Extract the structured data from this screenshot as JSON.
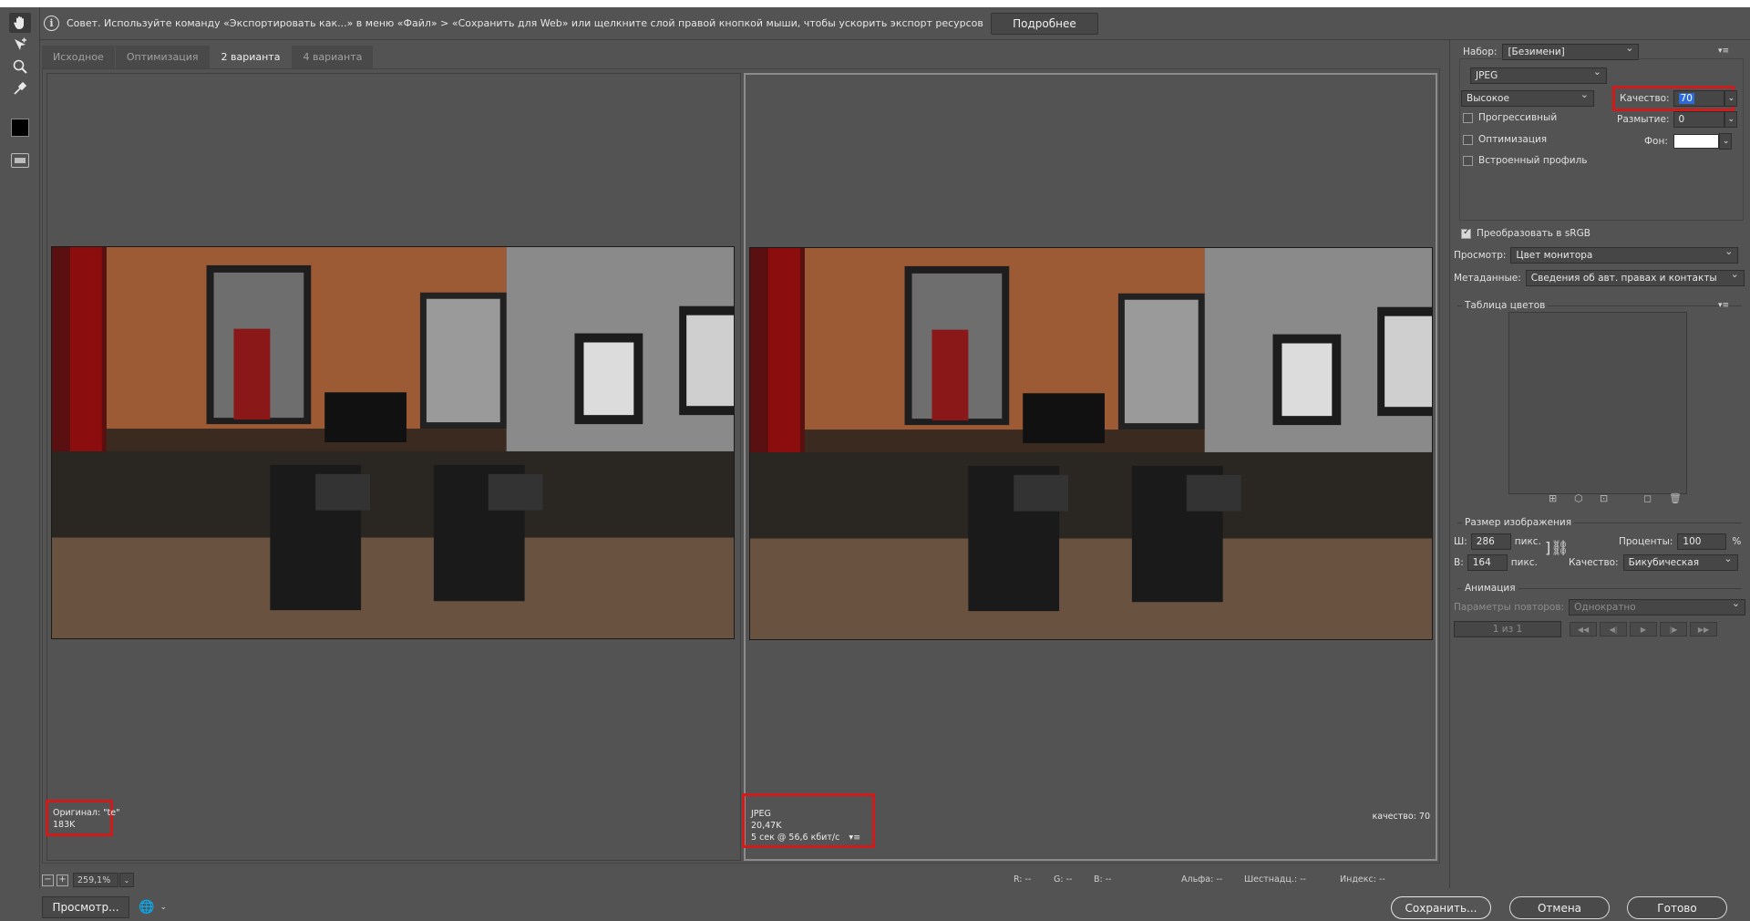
{
  "tip": {
    "text": "Совет. Используйте команду «Экспортировать как...» в меню «Файл» > «Сохранить для Web» или щелкните слой правой кнопкой мыши, чтобы ускорить экспорт ресурсов",
    "more_button": "Подробнее"
  },
  "tabs": [
    {
      "label": "Исходное",
      "active": false
    },
    {
      "label": "Оптимизация",
      "active": false
    },
    {
      "label": "2 варианта",
      "active": true
    },
    {
      "label": "4 варианта",
      "active": false
    }
  ],
  "left_pane": {
    "line1": "Оригинал: \"te\"",
    "line2": "183K"
  },
  "right_pane": {
    "line1": "JPEG",
    "line2": "20,47K",
    "line3": "5 сек @ 56,6 кбит/с",
    "quality": "качество: 70"
  },
  "status": {
    "zoom": "259,1%",
    "r": "R: --",
    "g": "G: --",
    "b": "B: --",
    "alpha": "Альфа: --",
    "hex": "Шестнадц.: --",
    "index": "Индекс: --"
  },
  "bottom": {
    "preview_button": "Просмотр...",
    "save_button": "Сохранить...",
    "cancel_button": "Отмена",
    "done_button": "Готово"
  },
  "panel": {
    "preset_label": "Набор:",
    "preset_value": "[Безимени]",
    "format_value": "JPEG",
    "quality_level": "Высокое",
    "quality_label": "Качество:",
    "quality_value": "70",
    "progressive_label": "Прогрессивный",
    "blur_label": "Размытие:",
    "blur_value": "0",
    "optimize_label": "Оптимизация",
    "matte_label": "Фон:",
    "embed_profile_label": "Встроенный профиль",
    "convert_srgb_label": "Преобразовать в sRGB",
    "preview_label": "Просмотр:",
    "preview_value": "Цвет монитора",
    "metadata_label": "Метаданные:",
    "metadata_value": "Сведения об авт. правах и контакты",
    "color_table_title": "Таблица цветов",
    "image_size_title": "Размер изображения",
    "width_label": "Ш:",
    "width_value": "286",
    "height_label": "В:",
    "height_value": "164",
    "unit": "пикс.",
    "percent_label": "Проценты:",
    "percent_value": "100",
    "percent_sign": "%",
    "resample_label": "Качество:",
    "resample_value": "Бикубическая",
    "animation_title": "Анимация",
    "loop_label": "Параметры повторов:",
    "loop_value": "Однократно",
    "frame_counter": "1 из 1"
  }
}
